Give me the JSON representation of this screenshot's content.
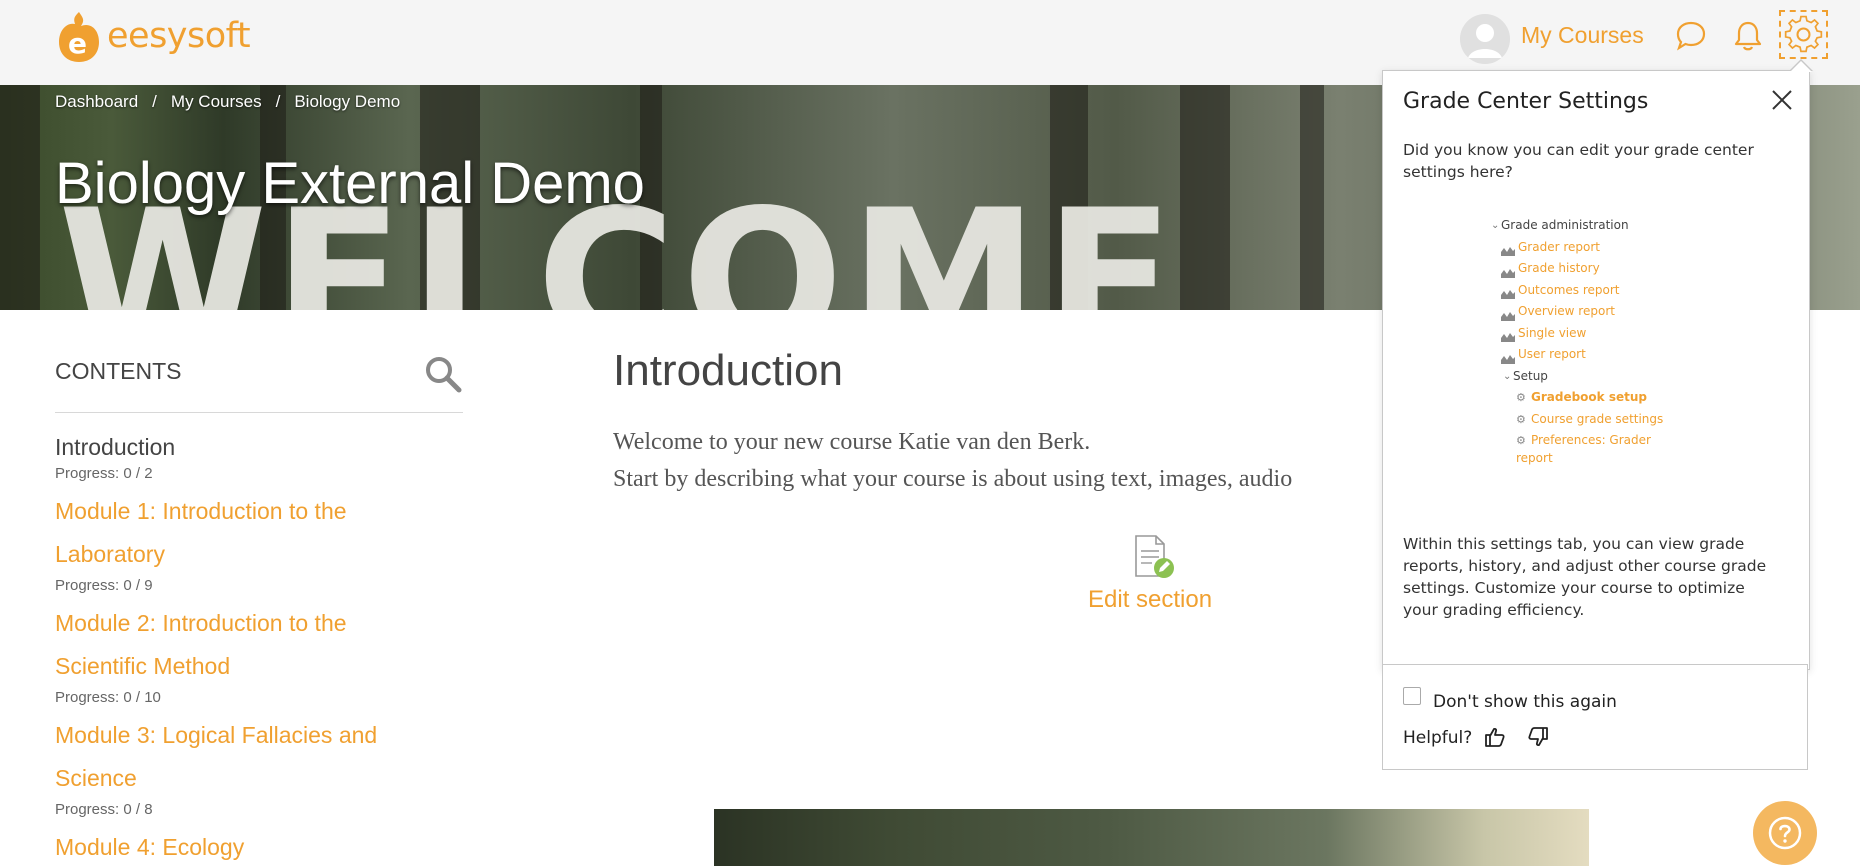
{
  "brand": {
    "name": "eesysoft",
    "logo_letter": "e"
  },
  "colors": {
    "accent": "#f0a030",
    "text": "#333333",
    "muted": "#666666"
  },
  "navbar": {
    "my_courses_label": "My Courses",
    "icons": [
      "avatar",
      "chat-icon",
      "bell-icon",
      "gear-icon"
    ]
  },
  "breadcrumb": [
    "Dashboard",
    "My Courses",
    "Biology Demo"
  ],
  "breadcrumb_sep": "/",
  "hero": {
    "course_title": "Biology External Demo",
    "background_text": "WELCOME"
  },
  "sidebar": {
    "heading": "CONTENTS",
    "items": [
      {
        "line1": "Introduction",
        "line2": "",
        "progress": "Progress: 0 / 2",
        "current": true
      },
      {
        "line1": "Module 1: Introduction to the",
        "line2": "Laboratory",
        "progress": "Progress: 0 / 9"
      },
      {
        "line1": "Module 2: Introduction to the",
        "line2": "Scientific Method",
        "progress": "Progress: 0 / 10"
      },
      {
        "line1": "Module 3: Logical Fallacies and",
        "line2": "Science",
        "progress": "Progress: 0 / 8"
      },
      {
        "line1": "Module 4: Ecology",
        "line2": "",
        "progress": ""
      }
    ]
  },
  "main": {
    "heading": "Introduction",
    "paragraph_line1": "Welcome to your new course Katie van den Berk.",
    "paragraph_line2": "Start by describing what your course is about using text, images, audio",
    "edit_section_label": "Edit section"
  },
  "popover": {
    "title": "Grade Center Settings",
    "intro": "Did you know you can edit your grade center settings here?",
    "tree": {
      "root": "Grade administration",
      "reports": [
        "Grader report",
        "Grade history",
        "Outcomes report",
        "Overview report",
        "Single view",
        "User report"
      ],
      "setup_label": "Setup",
      "setup_items": [
        "Gradebook setup",
        "Course grade settings",
        "Preferences: Grader",
        "report"
      ]
    },
    "description": "Within this settings tab, you can view grade reports, history, and adjust other course grade settings. Customize your course to optimize your grading efficiency.",
    "dont_show_label": "Don't show this again",
    "helpful_label": "Helpful?"
  }
}
